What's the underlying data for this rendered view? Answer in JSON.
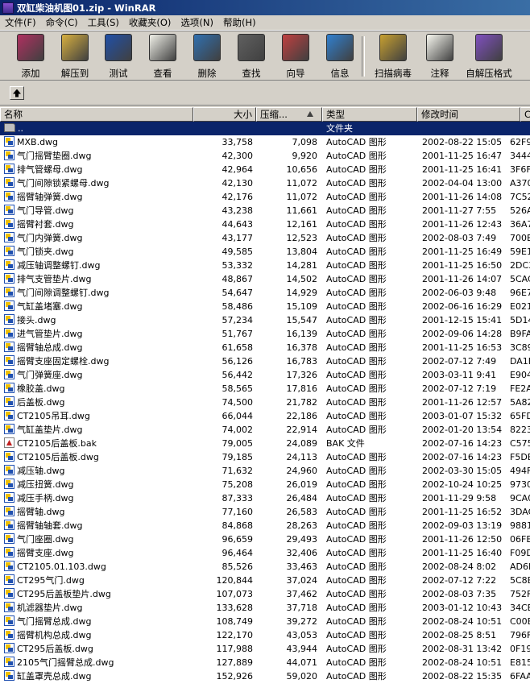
{
  "window": {
    "title": "双缸柴油机图01.zip - WinRAR"
  },
  "menu": [
    "文件(F)",
    "命令(C)",
    "工具(S)",
    "收藏夹(O)",
    "选项(N)",
    "帮助(H)"
  ],
  "toolbar": [
    {
      "label": "添加",
      "icon": "add-books-icon",
      "color": "#b03060"
    },
    {
      "label": "解压到",
      "icon": "extract-to-icon",
      "color": "#d8b040"
    },
    {
      "label": "测试",
      "icon": "test-icon",
      "color": "#2050a8"
    },
    {
      "label": "查看",
      "icon": "view-glasses-icon",
      "color": "#f0f0e8"
    },
    {
      "label": "删除",
      "icon": "delete-icon",
      "color": "#3070b0"
    },
    {
      "label": "查找",
      "icon": "binoculars-icon",
      "color": "#606060"
    },
    {
      "label": "向导",
      "icon": "wizard-icon",
      "color": "#c04040"
    },
    {
      "label": "信息",
      "icon": "info-icon",
      "color": "#3080d0"
    },
    {
      "label": "扫描病毒",
      "icon": "virus-scan-icon",
      "color": "#c8a030"
    },
    {
      "label": "注释",
      "icon": "comment-icon",
      "color": "#f8f8f0"
    },
    {
      "label": "自解压格式",
      "icon": "sfx-icon",
      "color": "#8050c0"
    }
  ],
  "columns": {
    "name": "名称",
    "size": "大小",
    "packed": "压缩...",
    "type": "类型",
    "modified": "修改时间",
    "crc": "CR"
  },
  "parent_row": {
    "name": "..",
    "type": "文件夹"
  },
  "files": [
    {
      "name": "MXB.dwg",
      "size": "33,758",
      "packed": "7,098",
      "type": "AutoCAD 图形",
      "modified": "2002-08-22 15:05",
      "crc": "62F9"
    },
    {
      "name": "气门摇臂垫圈.dwg",
      "size": "42,300",
      "packed": "9,920",
      "type": "AutoCAD 图形",
      "modified": "2001-11-25 16:47",
      "crc": "3444"
    },
    {
      "name": "排气管螺母.dwg",
      "size": "42,964",
      "packed": "10,656",
      "type": "AutoCAD 图形",
      "modified": "2001-11-25 16:41",
      "crc": "3F6F"
    },
    {
      "name": "气门间隙锁紧螺母.dwg",
      "size": "42,130",
      "packed": "11,072",
      "type": "AutoCAD 图形",
      "modified": "2002-04-04 13:00",
      "crc": "A370"
    },
    {
      "name": "摇臂轴弹簧.dwg",
      "size": "42,176",
      "packed": "11,072",
      "type": "AutoCAD 图形",
      "modified": "2001-11-26 14:08",
      "crc": "7C52"
    },
    {
      "name": "气门导管.dwg",
      "size": "43,238",
      "packed": "11,661",
      "type": "AutoCAD 图形",
      "modified": "2001-11-27 7:55",
      "crc": "526A"
    },
    {
      "name": "摇臂衬套.dwg",
      "size": "44,643",
      "packed": "12,161",
      "type": "AutoCAD 图形",
      "modified": "2001-11-26 12:43",
      "crc": "36A7"
    },
    {
      "name": "气门内弹簧.dwg",
      "size": "43,177",
      "packed": "12,523",
      "type": "AutoCAD 图形",
      "modified": "2002-08-03 7:49",
      "crc": "700B"
    },
    {
      "name": "气门锁夹.dwg",
      "size": "49,585",
      "packed": "13,804",
      "type": "AutoCAD 图形",
      "modified": "2001-11-25 16:49",
      "crc": "59E1"
    },
    {
      "name": "减压轴调整螺钉.dwg",
      "size": "53,332",
      "packed": "14,281",
      "type": "AutoCAD 图形",
      "modified": "2001-11-25 16:50",
      "crc": "2DC3"
    },
    {
      "name": "排气支管垫片.dwg",
      "size": "48,867",
      "packed": "14,502",
      "type": "AutoCAD 图形",
      "modified": "2001-11-26 14:07",
      "crc": "5CAC"
    },
    {
      "name": "气门间隙调整螺钉.dwg",
      "size": "54,647",
      "packed": "14,929",
      "type": "AutoCAD 图形",
      "modified": "2002-06-03 9:48",
      "crc": "96E7"
    },
    {
      "name": "气缸盖堵塞.dwg",
      "size": "58,486",
      "packed": "15,109",
      "type": "AutoCAD 图形",
      "modified": "2002-06-16 16:29",
      "crc": "E021"
    },
    {
      "name": "接头.dwg",
      "size": "57,234",
      "packed": "15,547",
      "type": "AutoCAD 图形",
      "modified": "2001-12-15 15:41",
      "crc": "5D14"
    },
    {
      "name": "进气管垫片.dwg",
      "size": "51,767",
      "packed": "16,139",
      "type": "AutoCAD 图形",
      "modified": "2002-09-06 14:28",
      "crc": "B9FA"
    },
    {
      "name": "摇臂轴总成.dwg",
      "size": "61,658",
      "packed": "16,378",
      "type": "AutoCAD 图形",
      "modified": "2001-11-25 16:53",
      "crc": "3C89"
    },
    {
      "name": "摇臂支座固定螺栓.dwg",
      "size": "56,126",
      "packed": "16,783",
      "type": "AutoCAD 图形",
      "modified": "2002-07-12 7:49",
      "crc": "DA1B"
    },
    {
      "name": "气门弹簧座.dwg",
      "size": "56,442",
      "packed": "17,326",
      "type": "AutoCAD 图形",
      "modified": "2003-03-11 9:41",
      "crc": "E904"
    },
    {
      "name": "橡胶盖.dwg",
      "size": "58,565",
      "packed": "17,816",
      "type": "AutoCAD 图形",
      "modified": "2002-07-12 7:19",
      "crc": "FE2A"
    },
    {
      "name": "后盖板.dwg",
      "size": "74,500",
      "packed": "21,782",
      "type": "AutoCAD 图形",
      "modified": "2001-11-26 12:57",
      "crc": "5A82"
    },
    {
      "name": "CT2105吊耳.dwg",
      "size": "66,044",
      "packed": "22,186",
      "type": "AutoCAD 图形",
      "modified": "2003-01-07 15:32",
      "crc": "65FD"
    },
    {
      "name": "气缸盖垫片.dwg",
      "size": "74,002",
      "packed": "22,914",
      "type": "AutoCAD 图形",
      "modified": "2002-01-20 13:54",
      "crc": "8223"
    },
    {
      "name": "CT2105后盖板.bak",
      "size": "79,005",
      "packed": "24,089",
      "type": "BAK 文件",
      "modified": "2002-07-16 14:23",
      "crc": "C575",
      "kind": "bak"
    },
    {
      "name": "CT2105后盖板.dwg",
      "size": "79,185",
      "packed": "24,113",
      "type": "AutoCAD 图形",
      "modified": "2002-07-16 14:23",
      "crc": "F5DE"
    },
    {
      "name": "减压轴.dwg",
      "size": "71,632",
      "packed": "24,960",
      "type": "AutoCAD 图形",
      "modified": "2002-03-30 15:05",
      "crc": "494F"
    },
    {
      "name": "减压扭簧.dwg",
      "size": "75,208",
      "packed": "26,019",
      "type": "AutoCAD 图形",
      "modified": "2002-10-24 10:25",
      "crc": "9730"
    },
    {
      "name": "减压手柄.dwg",
      "size": "87,333",
      "packed": "26,484",
      "type": "AutoCAD 图形",
      "modified": "2001-11-29 9:58",
      "crc": "9CA0"
    },
    {
      "name": "摇臂轴.dwg",
      "size": "77,160",
      "packed": "26,583",
      "type": "AutoCAD 图形",
      "modified": "2001-11-25 16:52",
      "crc": "3DAC"
    },
    {
      "name": "摇臂轴轴套.dwg",
      "size": "84,868",
      "packed": "28,263",
      "type": "AutoCAD 图形",
      "modified": "2002-09-03 13:19",
      "crc": "9881"
    },
    {
      "name": "气门座圈.dwg",
      "size": "96,659",
      "packed": "29,493",
      "type": "AutoCAD 图形",
      "modified": "2001-11-26 12:50",
      "crc": "06FE"
    },
    {
      "name": "摇臂支座.dwg",
      "size": "96,464",
      "packed": "32,406",
      "type": "AutoCAD 图形",
      "modified": "2001-11-25 16:40",
      "crc": "F09D"
    },
    {
      "name": "CT2105.01.103.dwg",
      "size": "85,526",
      "packed": "33,463",
      "type": "AutoCAD 图形",
      "modified": "2002-08-24 8:02",
      "crc": "AD6E"
    },
    {
      "name": "CT295气门.dwg",
      "size": "120,844",
      "packed": "37,024",
      "type": "AutoCAD 图形",
      "modified": "2002-07-12 7:22",
      "crc": "5C8B"
    },
    {
      "name": "CT295后盖板垫片.dwg",
      "size": "107,073",
      "packed": "37,462",
      "type": "AutoCAD 图形",
      "modified": "2002-08-03 7:35",
      "crc": "752F"
    },
    {
      "name": "机滤器垫片.dwg",
      "size": "133,628",
      "packed": "37,718",
      "type": "AutoCAD 图形",
      "modified": "2003-01-12 10:43",
      "crc": "34CB"
    },
    {
      "name": "气门摇臂总成.dwg",
      "size": "108,749",
      "packed": "39,272",
      "type": "AutoCAD 图形",
      "modified": "2002-08-24 10:51",
      "crc": "C00B"
    },
    {
      "name": "摇臂机构总成.dwg",
      "size": "122,170",
      "packed": "43,053",
      "type": "AutoCAD 图形",
      "modified": "2002-08-25 8:51",
      "crc": "796F"
    },
    {
      "name": "CT295后盖板.dwg",
      "size": "117,988",
      "packed": "43,944",
      "type": "AutoCAD 图形",
      "modified": "2002-08-31 13:42",
      "crc": "0F19"
    },
    {
      "name": "2105气门摇臂总成.dwg",
      "size": "127,889",
      "packed": "44,071",
      "type": "AutoCAD 图形",
      "modified": "2002-08-24 10:51",
      "crc": "E815"
    },
    {
      "name": "缸盖罩壳总成.dwg",
      "size": "152,926",
      "packed": "59,020",
      "type": "AutoCAD 图形",
      "modified": "2002-08-22 15:35",
      "crc": "6FAA"
    }
  ]
}
